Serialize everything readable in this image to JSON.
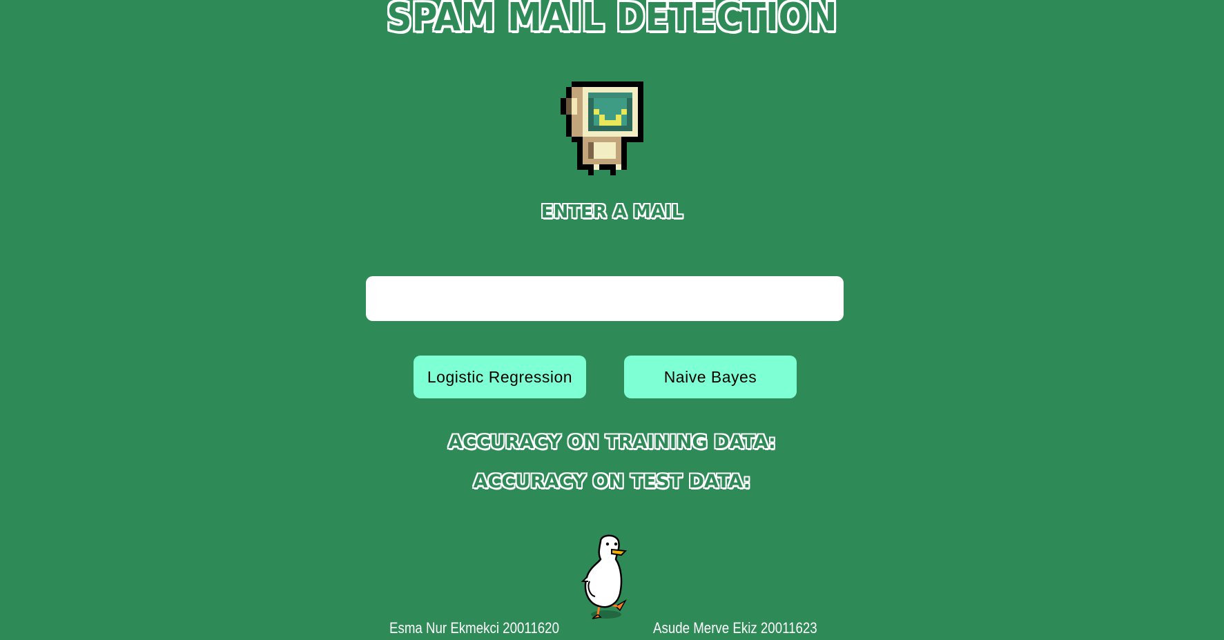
{
  "header": {
    "title": "SPAM MAIL DETECTION"
  },
  "form": {
    "prompt": "ENTER A MAIL",
    "mail_input_value": "",
    "mail_input_placeholder": ""
  },
  "buttons": {
    "logistic_regression": "Logistic Regression",
    "naive_bayes": "Naive Bayes"
  },
  "results": {
    "training_accuracy_label": "ACCURACY ON TRAINING DATA:",
    "test_accuracy_label": "ACCURACY ON TEST DATA:"
  },
  "footer": {
    "author_1": "Esma Nur Ekmekci 20011620",
    "author_2": "Asude Merve Ekiz 20011623"
  },
  "icons": {
    "robot": "pixel-robot-icon",
    "duck": "duck-icon"
  },
  "colors": {
    "background": "#2e8b57",
    "button": "#7fffd4",
    "input": "#ffffff",
    "outline_text": "#ffffff"
  }
}
